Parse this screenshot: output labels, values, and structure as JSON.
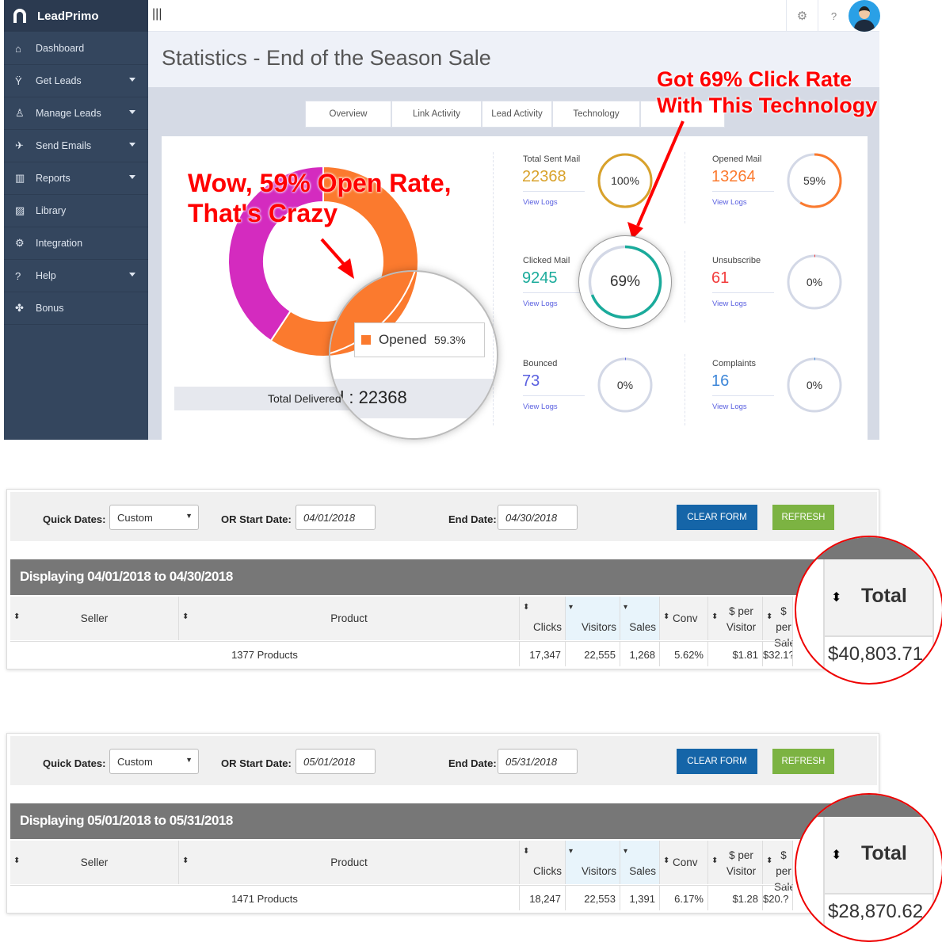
{
  "app": {
    "name": "LeadPrimo",
    "menu_icon": "|||"
  },
  "sidebar": {
    "items": [
      {
        "label": "Dashboard",
        "icon": "home-icon",
        "glyph": "⌂",
        "caret": false
      },
      {
        "label": "Get Leads",
        "icon": "funnel-icon",
        "glyph": "Ÿ",
        "caret": true
      },
      {
        "label": "Manage Leads",
        "icon": "hierarchy-icon",
        "glyph": "♙",
        "caret": true
      },
      {
        "label": "Send Emails",
        "icon": "paper-plane-icon",
        "glyph": "✈",
        "caret": true
      },
      {
        "label": "Reports",
        "icon": "bar-chart-icon",
        "glyph": "▥",
        "caret": true
      },
      {
        "label": "Library",
        "icon": "image-icon",
        "glyph": "▨",
        "caret": false
      },
      {
        "label": "Integration",
        "icon": "gears-icon",
        "glyph": "⚙",
        "caret": false
      },
      {
        "label": "Help",
        "icon": "question-icon",
        "glyph": "?",
        "caret": true
      },
      {
        "label": "Bonus",
        "icon": "gift-icon",
        "glyph": "✤",
        "caret": false
      }
    ]
  },
  "topbar": {
    "settings": "⚙",
    "help": "?"
  },
  "page": {
    "title": "Statistics - End of the Season Sale"
  },
  "tabs": [
    "Overview",
    "Link Activity",
    "Lead Activity",
    "Technology"
  ],
  "donut": {
    "segments": [
      {
        "label": "Opened",
        "percent": 59.3,
        "color": "#fb7a2e"
      },
      {
        "label": "Other",
        "percent": 40.7,
        "color": "#d42bbf"
      }
    ],
    "tooltip_label": "Opened",
    "tooltip_value": "59.3%",
    "total_label": "Total Delivered : ",
    "total_value": "22368"
  },
  "annotations": {
    "open_line1": "Wow, 59% Open Rate,",
    "open_line2": "That's Crazy",
    "click_line1": "Got 69% Click Rate",
    "click_line2": "With This Technology"
  },
  "stats": [
    {
      "label": "Total Sent Mail",
      "value": "22368",
      "percent": 100,
      "percent_text": "100%",
      "color": "#d9a22b",
      "link": "View Logs"
    },
    {
      "label": "Opened Mail",
      "value": "13264",
      "percent": 59,
      "percent_text": "59%",
      "color": "#fb7a2e",
      "link": "View Logs"
    },
    {
      "label": "Clicked Mail",
      "value": "9245",
      "percent": 69,
      "percent_text": "69%",
      "color": "#1aab9b",
      "link": "View Logs"
    },
    {
      "label": "Unsubscribe",
      "value": "61",
      "percent": 0,
      "percent_text": "0%",
      "color": "#f23b3b",
      "link": "View Logs"
    },
    {
      "label": "Bounced",
      "value": "73",
      "percent": 0,
      "percent_text": "0%",
      "color": "#5a60e0",
      "link": "View Logs"
    },
    {
      "label": "Complaints",
      "value": "16",
      "percent": 0,
      "percent_text": "0%",
      "color": "#3d86d8",
      "link": "View Logs"
    }
  ],
  "reports": [
    {
      "quick_label": "Quick Dates:",
      "quick_value": "Custom",
      "start_label": "OR Start Date:",
      "start": "04/01/2018",
      "end_label": "End Date:",
      "end": "04/30/2018",
      "clear": "CLEAR FORM",
      "refresh": "REFRESH",
      "display": "Displaying 04/01/2018 to 04/30/2018",
      "headers": [
        "Seller",
        "Product",
        "Clicks",
        "Visitors",
        "Sales",
        "Conv",
        "$ per Visitor",
        "$ per Sale",
        "Total"
      ],
      "row": {
        "product": "1377 Products",
        "clicks": "17,347",
        "visitors": "22,555",
        "sales": "1,268",
        "conv": "5.62%",
        "per_visitor": "$1.81",
        "per_sale": "$32.1?",
        "total": "$40,803.71"
      }
    },
    {
      "quick_label": "Quick Dates:",
      "quick_value": "Custom",
      "start_label": "OR Start Date:",
      "start": "05/01/2018",
      "end_label": "End Date:",
      "end": "05/31/2018",
      "clear": "CLEAR FORM",
      "refresh": "REFRESH",
      "display": "Displaying 05/01/2018 to 05/31/2018",
      "headers": [
        "Seller",
        "Product",
        "Clicks",
        "Visitors",
        "Sales",
        "Conv",
        "$ per Visitor",
        "$ per Sale",
        "Total"
      ],
      "row": {
        "product": "1471 Products",
        "clicks": "18,247",
        "visitors": "22,553",
        "sales": "1,391",
        "conv": "6.17%",
        "per_visitor": "$1.28",
        "per_sale": "$20.?",
        "total": "$28,870.62"
      }
    }
  ],
  "colors": {
    "sidebar": "#34465e",
    "clear_button": "#1565a8",
    "refresh_button": "#7cb342"
  }
}
